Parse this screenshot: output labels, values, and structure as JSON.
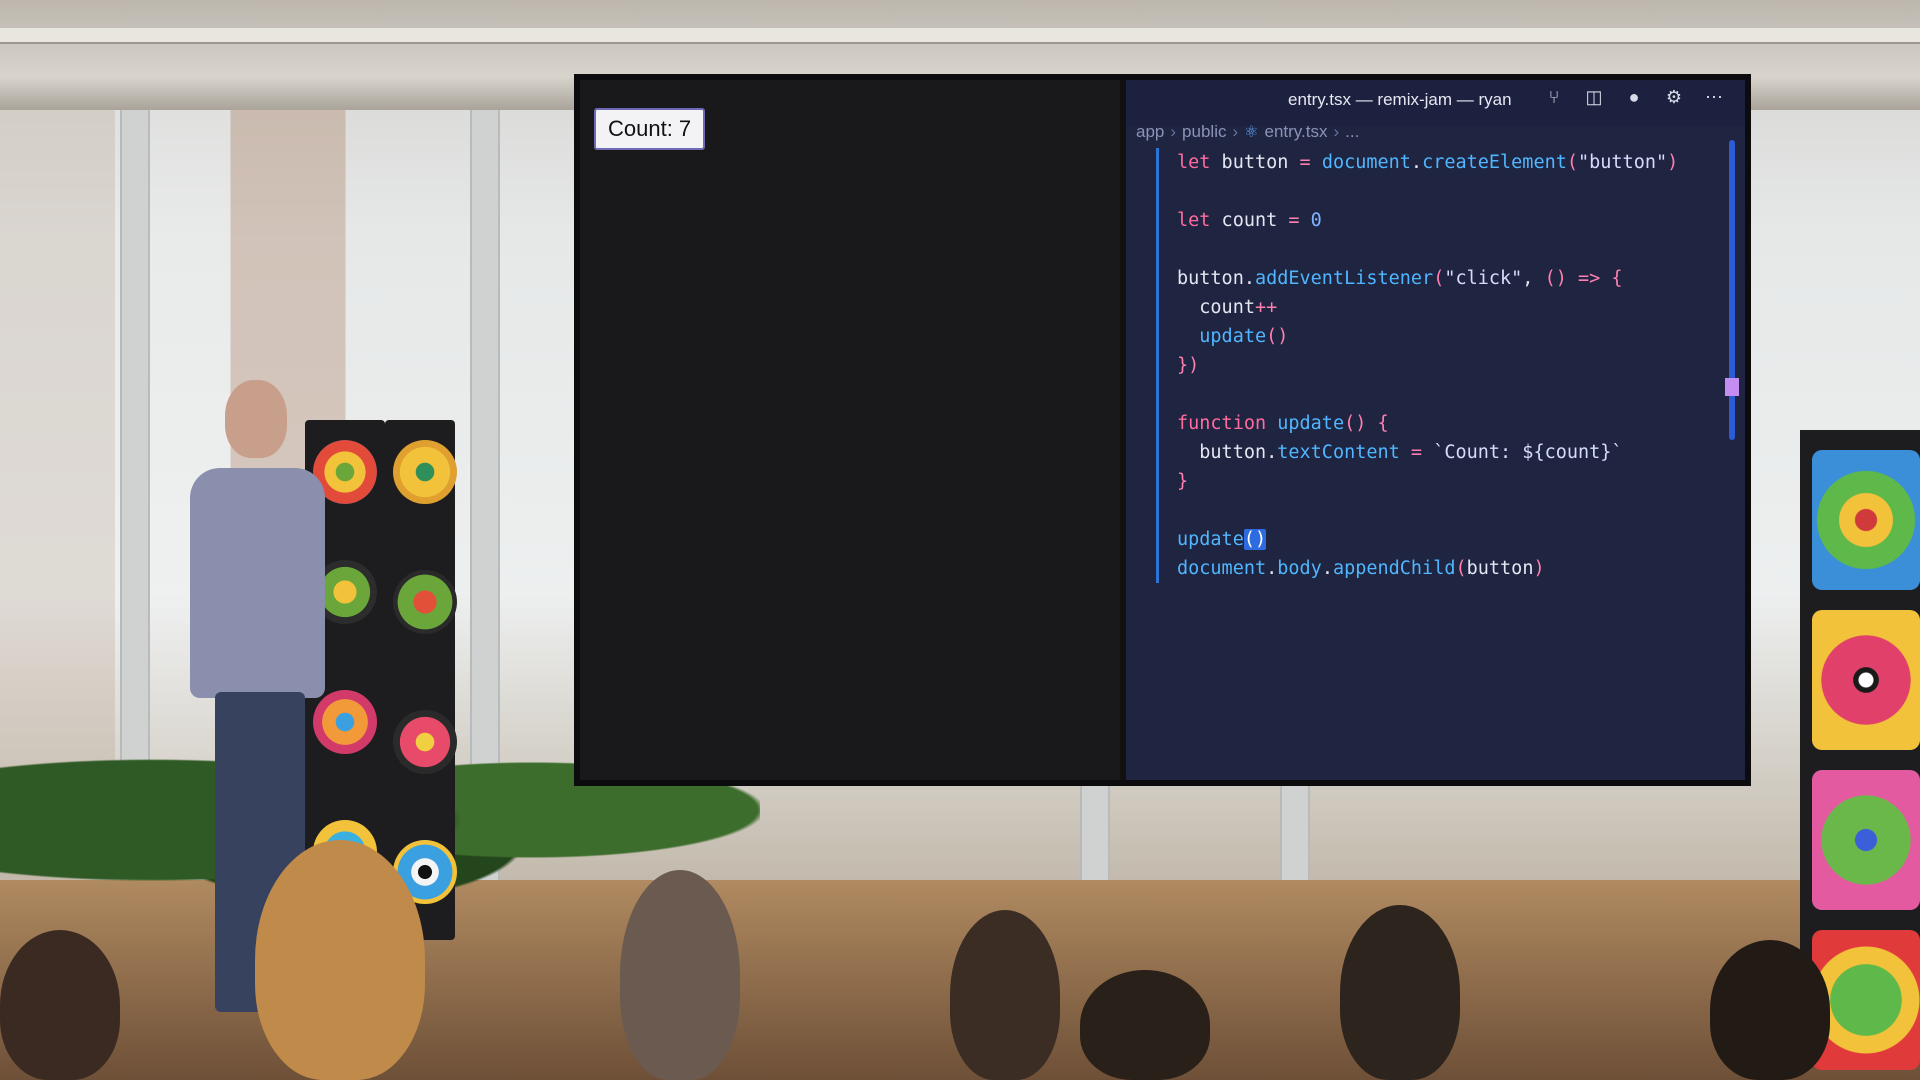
{
  "browser": {
    "count_button_label": "Count: 7"
  },
  "editor": {
    "title": "entry.tsx — remix-jam — ryan",
    "breadcrumb": [
      "app",
      "public",
      "entry.tsx",
      "..."
    ],
    "icons": [
      "source-control-icon",
      "split-editor-icon",
      "unsaved-dot-icon",
      "settings-gear-icon",
      "more-icon"
    ],
    "code_lines": [
      "let button = document.createElement(\"button\")",
      "",
      "let count = 0",
      "",
      "button.addEventListener(\"click\", () => {",
      "  count++",
      "  update()",
      "})",
      "",
      "function update() {",
      "  button.textContent = `Count: ${count}`",
      "}",
      "",
      "update()",
      "document.body.appendChild(button)"
    ]
  },
  "colors": {
    "editor_bg": "#1f2440",
    "keyword": "#ff6b9e",
    "function": "#4fb6ff",
    "accent": "#2c73d6"
  }
}
